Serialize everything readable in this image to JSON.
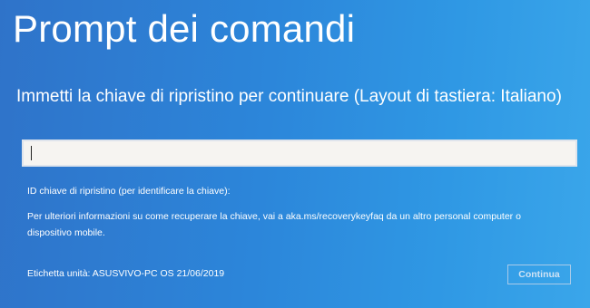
{
  "header": {
    "title": "Prompt dei comandi"
  },
  "main": {
    "prompt": "Immetti la chiave di ripristino per continuare (Layout di tastiera: Italiano)",
    "key_input": {
      "value": "",
      "placeholder": ""
    },
    "key_id_label": "ID chiave di ripristino (per identificare la chiave):",
    "info_text": "Per ulteriori informazioni su come recuperare la chiave, vai a aka.ms/recoverykeyfaq da un altro personal computer o dispositivo mobile.",
    "drive_label": "Etichetta unità: ASUSVIVO-PC OS 21/06/2019"
  },
  "footer": {
    "continue_label": "Continua"
  },
  "colors": {
    "background": "#2c86da",
    "input_background": "#f6f4f1",
    "text": "#ffffff",
    "disabled_button_text": "#cfe2f4"
  }
}
